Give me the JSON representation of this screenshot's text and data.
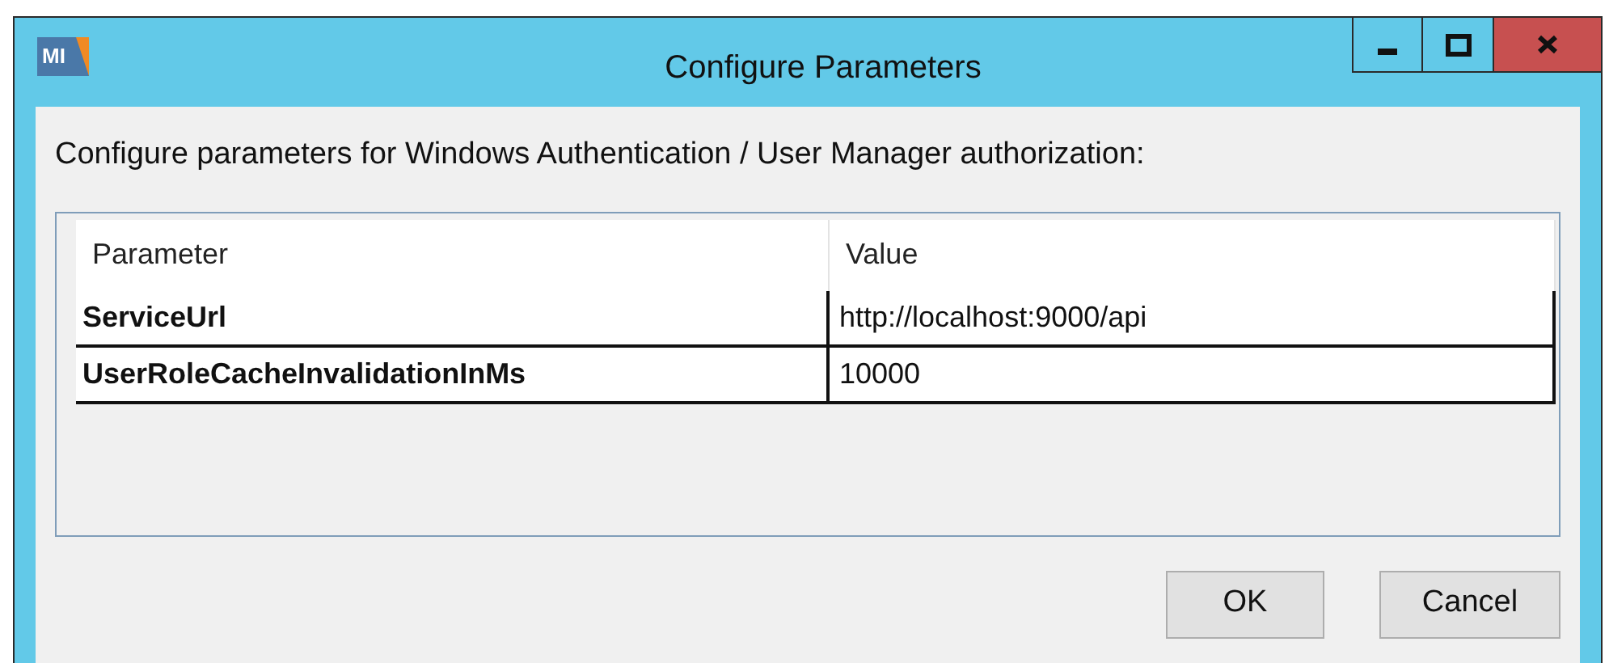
{
  "window": {
    "logo": "MI",
    "title": "Configure Parameters"
  },
  "description": "Configure parameters for Windows Authentication / User Manager authorization:",
  "table": {
    "columns": [
      "Parameter",
      "Value"
    ],
    "rows": [
      {
        "parameter": "ServiceUrl",
        "value": "http://localhost:9000/api"
      },
      {
        "parameter": "UserRoleCacheInvalidationInMs",
        "value": "10000"
      }
    ]
  },
  "buttons": [
    "OK",
    "Cancel"
  ]
}
